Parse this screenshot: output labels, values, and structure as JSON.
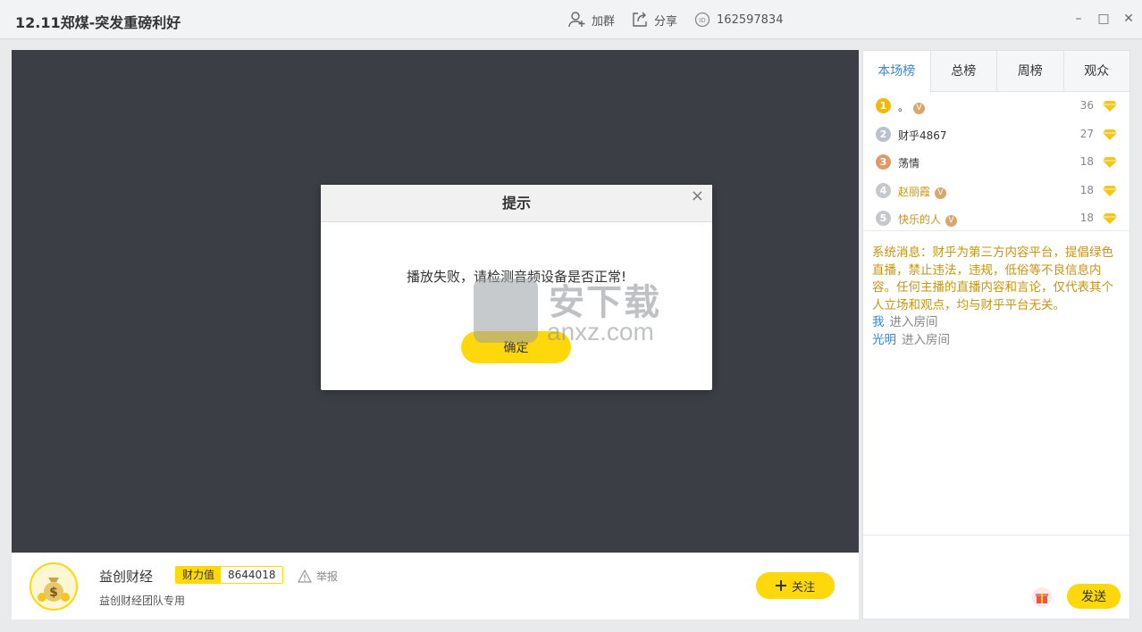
{
  "window": {
    "title": "12.11郑煤-突发重磅利好"
  },
  "topbar": {
    "join_group": "加群",
    "share": "分享",
    "room_id": "162597834"
  },
  "modal": {
    "title": "提示",
    "message": "播放失败，请检测音频设备是否正常!",
    "ok": "确定",
    "close": "×"
  },
  "watermark": {
    "big": "安下载",
    "small": "anxz.com"
  },
  "anchor": {
    "name": "益创财经",
    "wealth_label": "财力值",
    "wealth_value": "8644018",
    "report": "举报",
    "description": "益创财经团队专用",
    "follow": "关注"
  },
  "panel": {
    "tabs": [
      {
        "label": "本场榜",
        "active": true
      },
      {
        "label": "总榜",
        "active": false
      },
      {
        "label": "周榜",
        "active": false
      },
      {
        "label": "观众",
        "active": false
      }
    ],
    "ranking": [
      {
        "rank": "1",
        "name": "。",
        "vip": true,
        "score": "36",
        "color": "#f0b90b",
        "name_color": "#333"
      },
      {
        "rank": "2",
        "name": "财乎4867",
        "vip": false,
        "score": "27",
        "color": "#b9c2cc",
        "name_color": "#333"
      },
      {
        "rank": "3",
        "name": "荡情",
        "vip": false,
        "score": "18",
        "color": "#e09a6a",
        "name_color": "#333"
      },
      {
        "rank": "4",
        "name": "赵丽霞",
        "vip": true,
        "score": "18",
        "color": "#c6c9cc",
        "name_color": "#c4960e"
      },
      {
        "rank": "5",
        "name": "快乐的人",
        "vip": true,
        "score": "18",
        "color": "#c6c9cc",
        "name_color": "#c4960e"
      }
    ],
    "system_message": "系统消息：财乎为第三方内容平台，提倡绿色直播，禁止违法，违规，低俗等不良信息内容。任何主播的直播内容和言论，仅代表其个人立场和观点，均与财乎平台无关。",
    "chat": [
      {
        "user": "我",
        "text": "进入房间"
      },
      {
        "user": "光明",
        "text": "进入房间"
      }
    ],
    "send": "发送"
  },
  "colors": {
    "accent": "#fed80a",
    "link": "#3a87c9",
    "system": "#c4960e"
  }
}
